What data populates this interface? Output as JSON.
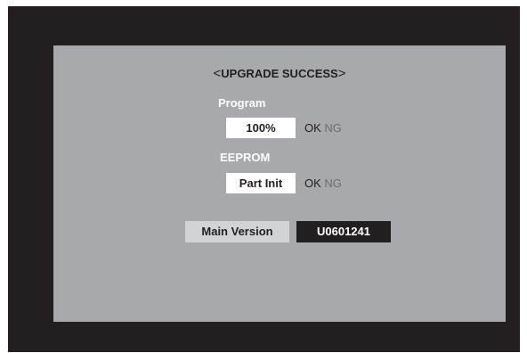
{
  "title": {
    "left_bracket": "<",
    "text": "UPGRADE SUCCESS",
    "right_bracket": ">"
  },
  "program": {
    "label": "Program",
    "value": "100%",
    "ok": "OK",
    "ng": "NG"
  },
  "eeprom": {
    "label": "EEPROM",
    "value": "Part Init",
    "ok": "OK",
    "ng": "NG"
  },
  "version": {
    "label": "Main Version",
    "value": "U0601241"
  },
  "colors": {
    "screen_background": "#231f20",
    "panel_background": "#a7a9ac",
    "ok_active": "#231f20",
    "ng_inactive": "#6d6e71"
  }
}
